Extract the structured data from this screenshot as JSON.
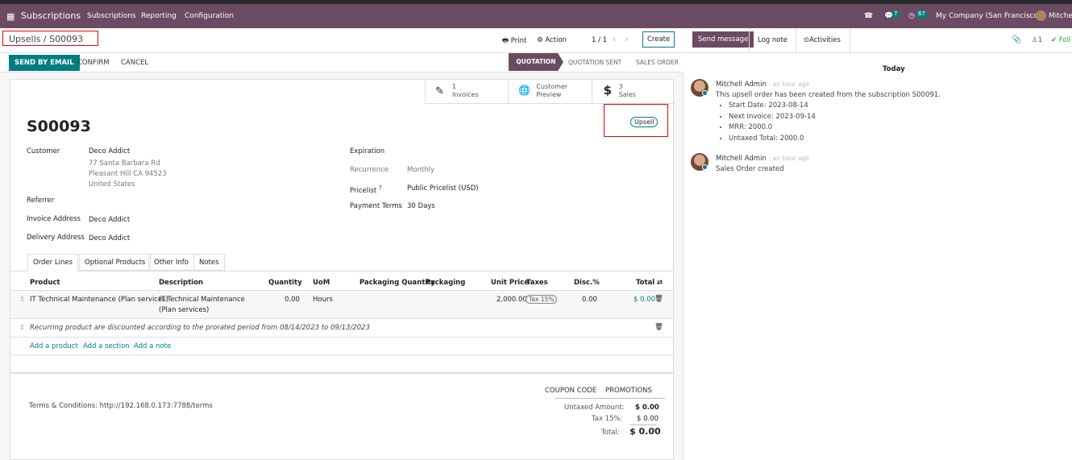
{
  "topbar": {
    "app": "Subscriptions",
    "menu": [
      "Subscriptions",
      "Reporting",
      "Configuration"
    ],
    "messages_count": "7",
    "activities_count": "67",
    "company": "My Company (San Francisco)",
    "user": "Mitchell"
  },
  "breadcrumb": {
    "parent": "Upsells",
    "current": "S00093"
  },
  "toolbar": {
    "print": "Print",
    "action": "Action",
    "pager": "1 / 1",
    "create": "Create"
  },
  "actions": {
    "send_email": "SEND BY EMAIL",
    "confirm": "CONFIRM",
    "cancel": "CANCEL"
  },
  "status": {
    "steps": [
      "QUOTATION",
      "QUOTATION SENT",
      "SALES ORDER"
    ],
    "active": "QUOTATION"
  },
  "smart_buttons": [
    {
      "count": "1",
      "label": "Invoices"
    },
    {
      "count": "Customer",
      "label": "Preview"
    },
    {
      "count": "3",
      "label": "Sales"
    }
  ],
  "form": {
    "name": "S00093",
    "tag": "Upsell",
    "customer_label": "Customer",
    "customer": "Deco Addict",
    "address": [
      "77 Santa Barbara Rd",
      "Pleasant Hill CA 94523",
      "United States"
    ],
    "referrer_label": "Referrer",
    "invoice_address_label": "Invoice Address",
    "invoice_address": "Deco Addict",
    "delivery_address_label": "Delivery Address",
    "delivery_address": "Deco Addict",
    "expiration_label": "Expiration",
    "recurrence_label": "Recurrence",
    "recurrence": "Monthly",
    "pricelist_label": "Pricelist",
    "pricelist_help": "?",
    "pricelist": "Public Pricelist (USD)",
    "payment_terms_label": "Payment Terms",
    "payment_terms": "30 Days"
  },
  "tabs": [
    "Order Lines",
    "Optional Products",
    "Other Info",
    "Notes"
  ],
  "table": {
    "headers": [
      "Product",
      "Description",
      "Quantity",
      "UoM",
      "Packaging Quantity",
      "Packaging",
      "Unit Price",
      "Taxes",
      "Disc.%",
      "Total"
    ],
    "row": {
      "product": "IT Technical Maintenance (Plan services)",
      "description1": "IT Technical Maintenance",
      "description2": "(Plan services)",
      "quantity": "0.00",
      "uom": "Hours",
      "unit_price": "2,000.00",
      "tax": "Tax 15%",
      "disc": "0.00",
      "total": "$ 0.00"
    },
    "note": "Recurring product are discounted according to the prorated period from 08/14/2023 to 09/13/2023",
    "add": [
      "Add a product",
      "Add a section",
      "Add a note"
    ]
  },
  "footer": {
    "terms": "Terms & Conditions: http://192.168.0.173:7788/terms",
    "coupon": "COUPON CODE",
    "promotions": "PROMOTIONS",
    "untaxed_label": "Untaxed Amount:",
    "untaxed": "$ 0.00",
    "tax_label": "Tax 15%:",
    "tax": "$ 0.00",
    "total_label": "Total:",
    "total": "$ 0.00"
  },
  "chatter": {
    "send_message": "Send message",
    "log_note": "Log note",
    "activities": "Activities",
    "followers": "1",
    "follow": "Foll",
    "date": "Today",
    "messages": [
      {
        "author": "Mitchell Admin",
        "time": "- an hour ago",
        "body": "This upsell order has been created from the subscription S00091.",
        "bullets": [
          "Start Date: 2023-08-14",
          "Next Invoice: 2023-09-14",
          "MRR: 2000.0",
          "Untaxed Total: 2000.0"
        ]
      },
      {
        "author": "Mitchell Admin",
        "time": "- an hour ago",
        "body": "Sales Order created"
      }
    ]
  }
}
